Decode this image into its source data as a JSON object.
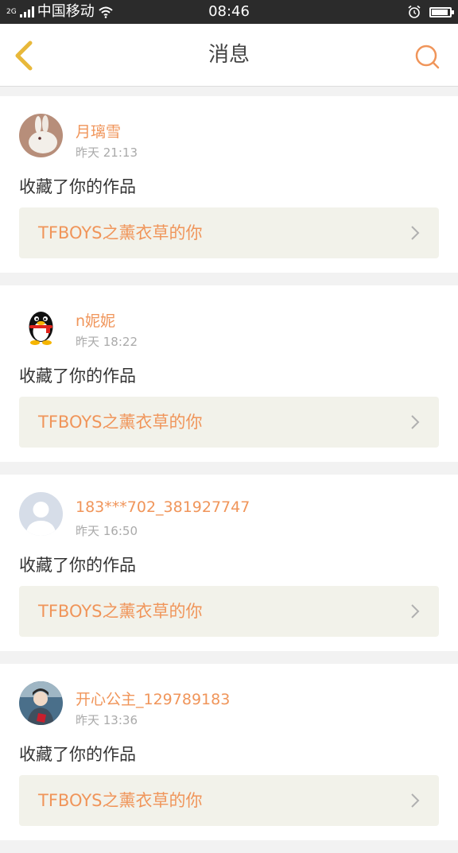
{
  "status_bar": {
    "network_tag": "2G",
    "carrier": "中国移动",
    "time": "08:46",
    "battery_level": 0.9
  },
  "header": {
    "title": "消息",
    "back_icon": "chevron-left-icon",
    "search_icon": "search-icon"
  },
  "colors": {
    "accent": "#f0955a",
    "back_icon": "#e8b83a"
  },
  "messages": [
    {
      "username": "月璃雪",
      "time": "昨天 21:13",
      "action": "收藏了你的作品",
      "work_title": "TFBOYS之薰衣草的你",
      "avatar": "rabbit-avatar"
    },
    {
      "username": "n妮妮",
      "time": "昨天 18:22",
      "action": "收藏了你的作品",
      "work_title": "TFBOYS之薰衣草的你",
      "avatar": "penguin-avatar"
    },
    {
      "username": "183***702_381927747",
      "time": "昨天 16:50",
      "action": "收藏了你的作品",
      "work_title": "TFBOYS之薰衣草的你",
      "avatar": "default-user-avatar"
    },
    {
      "username": "开心公主_129789183",
      "time": "昨天 13:36",
      "action": "收藏了你的作品",
      "work_title": "TFBOYS之薰衣草的你",
      "avatar": "photo-avatar"
    }
  ]
}
